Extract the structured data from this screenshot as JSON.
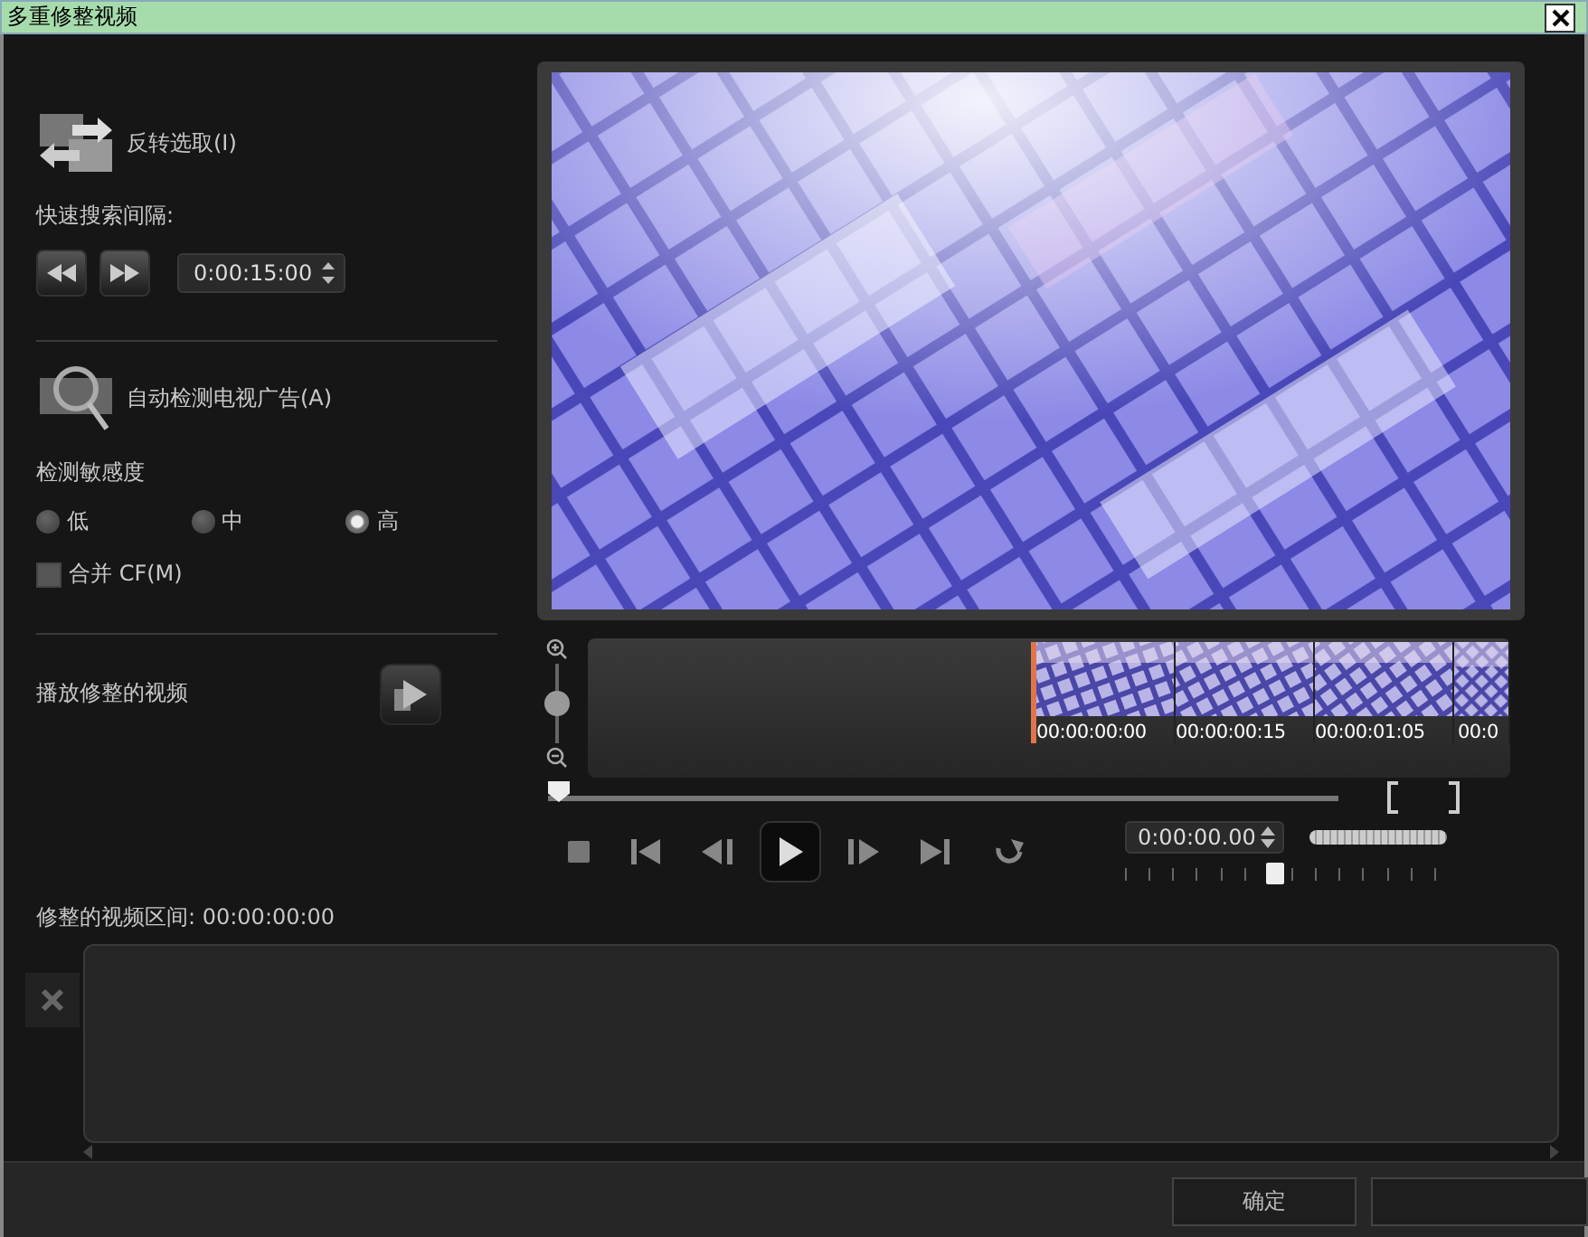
{
  "window": {
    "title": "多重修整视频"
  },
  "invert": {
    "label": "反转选取(I)"
  },
  "quick_search": {
    "label": "快速搜索间隔:",
    "time": "0:00:15:00"
  },
  "detect": {
    "label": "自动检测电视广告(A)",
    "sensitivity_label": "检测敏感度",
    "levels": [
      {
        "label": "低",
        "selected": false
      },
      {
        "label": "中",
        "selected": false
      },
      {
        "label": "高",
        "selected": true
      }
    ],
    "merge": {
      "label": "合并 CF(M)",
      "checked": false
    }
  },
  "play_trimmed": {
    "label": "播放修整的视频"
  },
  "zoom_slider": {
    "level": 0.5
  },
  "timeline": {
    "thumbnails": [
      {
        "time": "00:00:00:00"
      },
      {
        "time": "00:00:00:15"
      },
      {
        "time": "00:00:01:05"
      },
      {
        "time": "00:0"
      }
    ]
  },
  "scrubber": {
    "level": 0
  },
  "timecode": "0:00:00.00",
  "jog": {
    "level": 0.49
  },
  "trimmed_range": "修整的视频区间: 00:00:00:00",
  "buttons": [
    "确定"
  ]
}
